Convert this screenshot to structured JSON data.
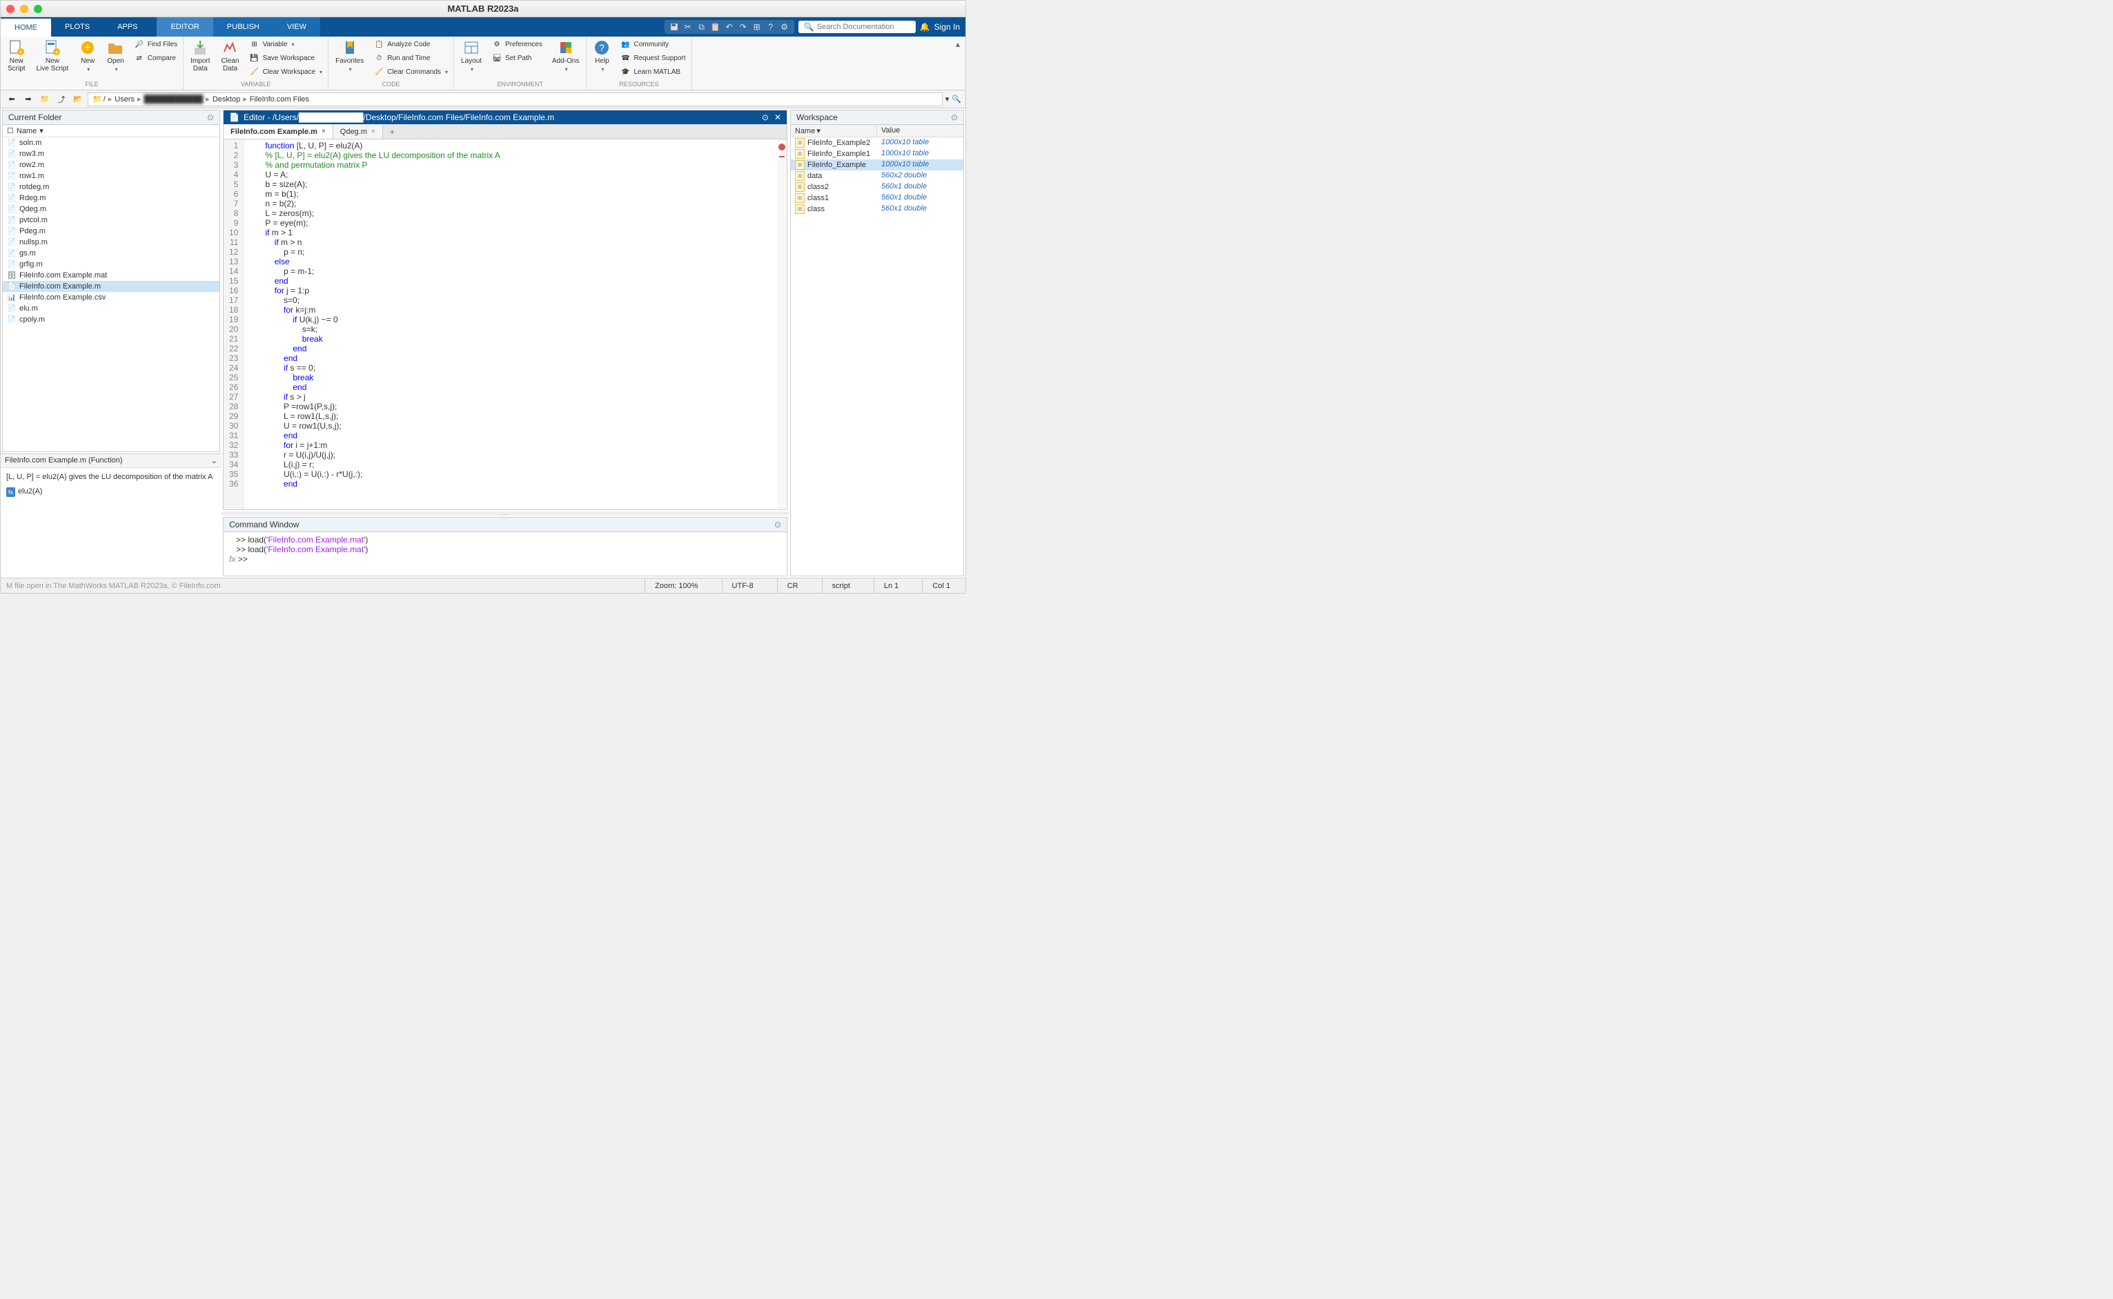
{
  "window": {
    "title": "MATLAB R2023a"
  },
  "tabs": {
    "home": "HOME",
    "plots": "PLOTS",
    "apps": "APPS",
    "editor": "EDITOR",
    "publish": "PUBLISH",
    "view": "VIEW"
  },
  "search_placeholder": "Search Documentation",
  "signin": "Sign In",
  "ribbon": {
    "new_script": "New\nScript",
    "new_live": "New\nLive Script",
    "new": "New",
    "open": "Open",
    "find_files": "Find Files",
    "compare": "Compare",
    "import": "Import\nData",
    "clean": "Clean\nData",
    "variable": "Variable",
    "save_ws": "Save Workspace",
    "clear_ws": "Clear Workspace",
    "favorites": "Favorites",
    "analyze": "Analyze Code",
    "runtime": "Run and Time",
    "clear_cmd": "Clear Commands",
    "layout": "Layout",
    "prefs": "Preferences",
    "setpath": "Set Path",
    "addons": "Add-Ons",
    "help": "Help",
    "community": "Community",
    "support": "Request Support",
    "learn": "Learn MATLAB",
    "grp_file": "FILE",
    "grp_variable": "VARIABLE",
    "grp_code": "CODE",
    "grp_env": "ENVIRONMENT",
    "grp_res": "RESOURCES"
  },
  "path": {
    "root": "/",
    "users": "Users",
    "user": "███████████",
    "desktop": "Desktop",
    "folder": "FileInfo.com Files"
  },
  "panels": {
    "current_folder": "Current Folder",
    "name_col": "Name",
    "editor_title": "Editor - /Users/███████████/Desktop/FileInfo.com Files/FileInfo.com Example.m",
    "workspace": "Workspace",
    "command_window": "Command Window",
    "ws_name": "Name",
    "ws_value": "Value"
  },
  "files": [
    {
      "name": "soln.m",
      "type": "m"
    },
    {
      "name": "row3.m",
      "type": "m"
    },
    {
      "name": "row2.m",
      "type": "m"
    },
    {
      "name": "row1.m",
      "type": "m"
    },
    {
      "name": "rotdeg.m",
      "type": "m"
    },
    {
      "name": "Rdeg.m",
      "type": "m"
    },
    {
      "name": "Qdeg.m",
      "type": "m"
    },
    {
      "name": "pvtcol.m",
      "type": "m"
    },
    {
      "name": "Pdeg.m",
      "type": "m"
    },
    {
      "name": "nullsp.m",
      "type": "m"
    },
    {
      "name": "gs.m",
      "type": "m"
    },
    {
      "name": "grfig.m",
      "type": "m"
    },
    {
      "name": "FileInfo.com Example.mat",
      "type": "mat"
    },
    {
      "name": "FileInfo.com Example.m",
      "type": "m",
      "selected": true
    },
    {
      "name": "FileInfo.com Example.csv",
      "type": "csv"
    },
    {
      "name": "elu.m",
      "type": "m"
    },
    {
      "name": "cpoly.m",
      "type": "m"
    }
  ],
  "details": {
    "header": "FileInfo.com Example.m  (Function)",
    "desc": "[L, U, P] = elu2(A) gives the LU decomposition of the matrix A",
    "func": "elu2(A)"
  },
  "editor_tabs": [
    {
      "label": "FileInfo.com Example.m",
      "active": true
    },
    {
      "label": "Qdeg.m"
    }
  ],
  "code": [
    {
      "n": 1,
      "html": "<span class='kw'>function</span> [L, U, P] = elu2(A)"
    },
    {
      "n": 2,
      "html": "<span class='cm'>% [L, U, P] = elu2(A) gives the LU decomposition of the matrix A</span>"
    },
    {
      "n": 3,
      "html": "<span class='cm'>% and permutation matrix P</span>"
    },
    {
      "n": 4,
      "html": "U = A;"
    },
    {
      "n": 5,
      "html": "b = size(A);"
    },
    {
      "n": 6,
      "html": "m = b(1);"
    },
    {
      "n": 7,
      "html": "n = b(2);"
    },
    {
      "n": 8,
      "html": "L = zeros(m);"
    },
    {
      "n": 9,
      "html": "P = eye(m);"
    },
    {
      "n": 10,
      "html": "<span class='kw'>if</span> m &gt; 1"
    },
    {
      "n": 11,
      "html": "    <span class='kw'>if</span> m &gt; n"
    },
    {
      "n": 12,
      "html": "        p = n;"
    },
    {
      "n": 13,
      "html": "    <span class='kw'>else</span>"
    },
    {
      "n": 14,
      "html": "        p = m-1;"
    },
    {
      "n": 15,
      "html": "    <span class='kw'>end</span>"
    },
    {
      "n": 16,
      "html": "    <span class='kw'>for</span> j = 1:p"
    },
    {
      "n": 17,
      "html": "        s=0;"
    },
    {
      "n": 18,
      "html": "        <span class='kw'>for</span> k=j:m"
    },
    {
      "n": 19,
      "html": "            <span class='kw'>if</span> U(k,j) ~= 0"
    },
    {
      "n": 20,
      "html": "                s=k;"
    },
    {
      "n": 21,
      "html": "                <span class='kw'>break</span>"
    },
    {
      "n": 22,
      "html": "            <span class='kw'>end</span>"
    },
    {
      "n": 23,
      "html": "        <span class='kw'>end</span>"
    },
    {
      "n": 24,
      "html": "        <span class='kw'>if</span> s == 0;"
    },
    {
      "n": 25,
      "html": "            <span class='kw'>break</span>"
    },
    {
      "n": 26,
      "html": "            <span class='kw'>end</span>"
    },
    {
      "n": 27,
      "html": "        <span class='kw'>if</span> s &gt; j"
    },
    {
      "n": 28,
      "html": "        P =row1(P,s,j);"
    },
    {
      "n": 29,
      "html": "        L = row1(L,s,j);"
    },
    {
      "n": 30,
      "html": "        U = row1(U,s,j);"
    },
    {
      "n": 31,
      "html": "        <span class='kw'>end</span>"
    },
    {
      "n": 32,
      "html": "        <span class='kw'>for</span> i = j+1:m"
    },
    {
      "n": 33,
      "html": "        r = U(i,j)/U(j,j);"
    },
    {
      "n": 34,
      "html": "        L(i,j) = r;"
    },
    {
      "n": 35,
      "html": "        U(i,:) = U(i,:) - r*U(j,:);"
    },
    {
      "n": 36,
      "html": "        <span class='kw'>end</span>"
    }
  ],
  "cmd": [
    {
      "html": "&gt;&gt; load(<span class='str'>'FileInfo.com Example.mat'</span>)"
    },
    {
      "html": "&gt;&gt; load(<span class='str'>'FileInfo.com Example.mat'</span>)"
    },
    {
      "html": "&gt;&gt; ",
      "prompt": true
    }
  ],
  "cmd_fx": "fx",
  "workspace": [
    {
      "name": "FileInfo_Example2",
      "value": "1000x10 table"
    },
    {
      "name": "FileInfo_Example1",
      "value": "1000x10 table"
    },
    {
      "name": "FileInfo_Example",
      "value": "1000x10 table",
      "selected": true
    },
    {
      "name": "data",
      "value": "560x2 double"
    },
    {
      "name": "class2",
      "value": "560x1 double"
    },
    {
      "name": "class1",
      "value": "560x1 double"
    },
    {
      "name": "class",
      "value": "560x1 double"
    }
  ],
  "status": {
    "left": "M file open in The MathWorks MATLAB R2023a. © FileInfo.com",
    "zoom": "Zoom: 100%",
    "enc": "UTF-8",
    "cr": "CR",
    "mode": "script",
    "ln": "Ln  1",
    "col": "Col  1"
  }
}
